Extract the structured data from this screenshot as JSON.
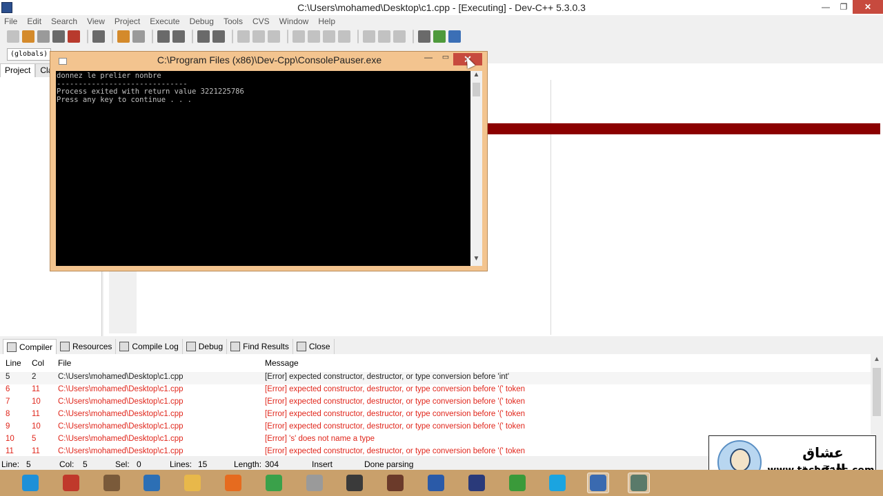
{
  "window": {
    "title": "C:\\Users\\mohamed\\Desktop\\c1.cpp - [Executing] - Dev-C++ 5.3.0.3"
  },
  "window_controls": {
    "minimize": "—",
    "restore": "❐",
    "close": "✕"
  },
  "menu": [
    "File",
    "Edit",
    "Search",
    "View",
    "Project",
    "Execute",
    "Debug",
    "Tools",
    "CVS",
    "Window",
    "Help"
  ],
  "toolbar": {
    "icons": [
      "new-file-icon",
      "open-icon",
      "save-icon",
      "save-all-icon",
      "close-file-icon",
      "print-icon",
      "undo-icon",
      "redo-icon",
      "find-icon",
      "replace-icon",
      "goto-line-icon",
      "indent-icon",
      "unindent-icon",
      "compile-icon",
      "run-icon",
      "compile-run-icon",
      "rebuild-icon",
      "check-icon",
      "debug-icon",
      "stop-icon",
      "new-project-icon",
      "add-file-icon",
      "options-icon"
    ]
  },
  "scope_combo": {
    "value": "(globals)"
  },
  "left_panel": {
    "tabs": [
      "Project",
      "Clas"
    ]
  },
  "console": {
    "title": "C:\\Program Files (x86)\\Dev-Cpp\\ConsolePauser.exe",
    "minimize": "—",
    "maximize": "▭",
    "close": "✕",
    "lines": [
      "donnez le prelier nonbre",
      "------------------------------",
      "Process exited with return value 3221225786",
      "Press any key to continue . . ."
    ],
    "scroll_up": "▲",
    "scroll_down": "▼"
  },
  "bottom_tabs": [
    "Compiler",
    "Resources",
    "Compile Log",
    "Debug",
    "Find Results",
    "Close"
  ],
  "messages": {
    "headers": {
      "line": "Line",
      "col": "Col",
      "file": "File",
      "message": "Message"
    },
    "rows": [
      {
        "line": "5",
        "col": "2",
        "file": "C:\\Users\\mohamed\\Desktop\\c1.cpp",
        "message": "[Error] expected constructor, destructor, or type conversion before 'int'"
      },
      {
        "line": "6",
        "col": "11",
        "file": "C:\\Users\\mohamed\\Desktop\\c1.cpp",
        "message": "[Error] expected constructor, destructor, or type conversion before '(' token"
      },
      {
        "line": "7",
        "col": "10",
        "file": "C:\\Users\\mohamed\\Desktop\\c1.cpp",
        "message": "[Error] expected constructor, destructor, or type conversion before '(' token"
      },
      {
        "line": "8",
        "col": "11",
        "file": "C:\\Users\\mohamed\\Desktop\\c1.cpp",
        "message": "[Error] expected constructor, destructor, or type conversion before '(' token"
      },
      {
        "line": "9",
        "col": "10",
        "file": "C:\\Users\\mohamed\\Desktop\\c1.cpp",
        "message": "[Error] expected constructor, destructor, or type conversion before '(' token"
      },
      {
        "line": "10",
        "col": "5",
        "file": "C:\\Users\\mohamed\\Desktop\\c1.cpp",
        "message": "[Error] 's' does not name a type"
      },
      {
        "line": "11",
        "col": "11",
        "file": "C:\\Users\\mohamed\\Desktop\\c1.cpp",
        "message": "[Error] expected constructor, destructor, or type conversion before '(' token"
      }
    ],
    "scroll_up": "▲"
  },
  "status": {
    "line_label": "Line:",
    "line_value": "5",
    "col_label": "Col:",
    "col_value": "5",
    "sel_label": "Sel:",
    "sel_value": "0",
    "lines_label": "Lines:",
    "lines_value": "15",
    "length_label": "Length:",
    "length_value": "304",
    "mode": "Insert",
    "state": "Done parsing"
  },
  "watermark": {
    "arabic": "عشاق التقنية",
    "url": "www.tech-fans.com",
    "logo_text": "tech-fans"
  },
  "taskbar": {
    "apps": [
      "internet-explorer-icon",
      "app-red-icon",
      "calendar-icon",
      "media-player-icon",
      "file-explorer-icon",
      "firefox-icon",
      "chrome-icon",
      "book-icon",
      "video-app-icon",
      "film-icon",
      "network-icon",
      "tool-icon",
      "utorrent-icon",
      "skype-icon",
      "devcpp-icon",
      "console-icon"
    ],
    "colors": [
      "#1e90d8",
      "#c0392b",
      "#7a5a3a",
      "#2c6fb5",
      "#e8b84a",
      "#e66b1f",
      "#3aa14a",
      "#9a9a9a",
      "#3a3a3a",
      "#6b3a2a",
      "#2a5aa8",
      "#2a3a7a",
      "#3a9a3a",
      "#1ba4e0",
      "#3a6ab0",
      "#5a7a6a"
    ]
  }
}
